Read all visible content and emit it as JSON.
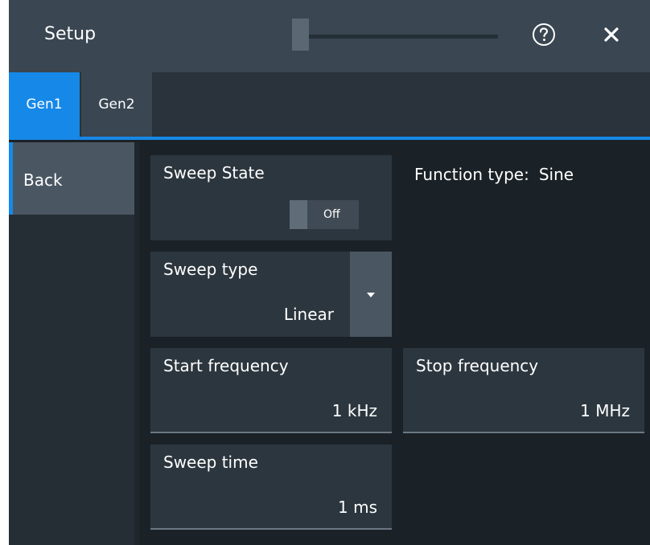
{
  "header": {
    "title": "Setup",
    "help_icon": "help-circle-icon",
    "close_icon": "close-icon"
  },
  "tabs": [
    {
      "label": "Gen1",
      "active": true
    },
    {
      "label": "Gen2",
      "active": false
    }
  ],
  "sidebar": {
    "back_label": "Back"
  },
  "sweep_state": {
    "label": "Sweep State",
    "toggle_value": "Off"
  },
  "function_type": {
    "label": "Function type:",
    "value": "Sine"
  },
  "sweep_type": {
    "label": "Sweep type",
    "value": "Linear"
  },
  "start_frequency": {
    "label": "Start frequency",
    "value": "1 kHz"
  },
  "stop_frequency": {
    "label": "Stop frequency",
    "value": "1 MHz"
  },
  "sweep_time": {
    "label": "Sweep time",
    "value": "1 ms"
  },
  "colors": {
    "accent": "#1688e8",
    "background": "#1b2227",
    "panel": "#2c363e"
  }
}
